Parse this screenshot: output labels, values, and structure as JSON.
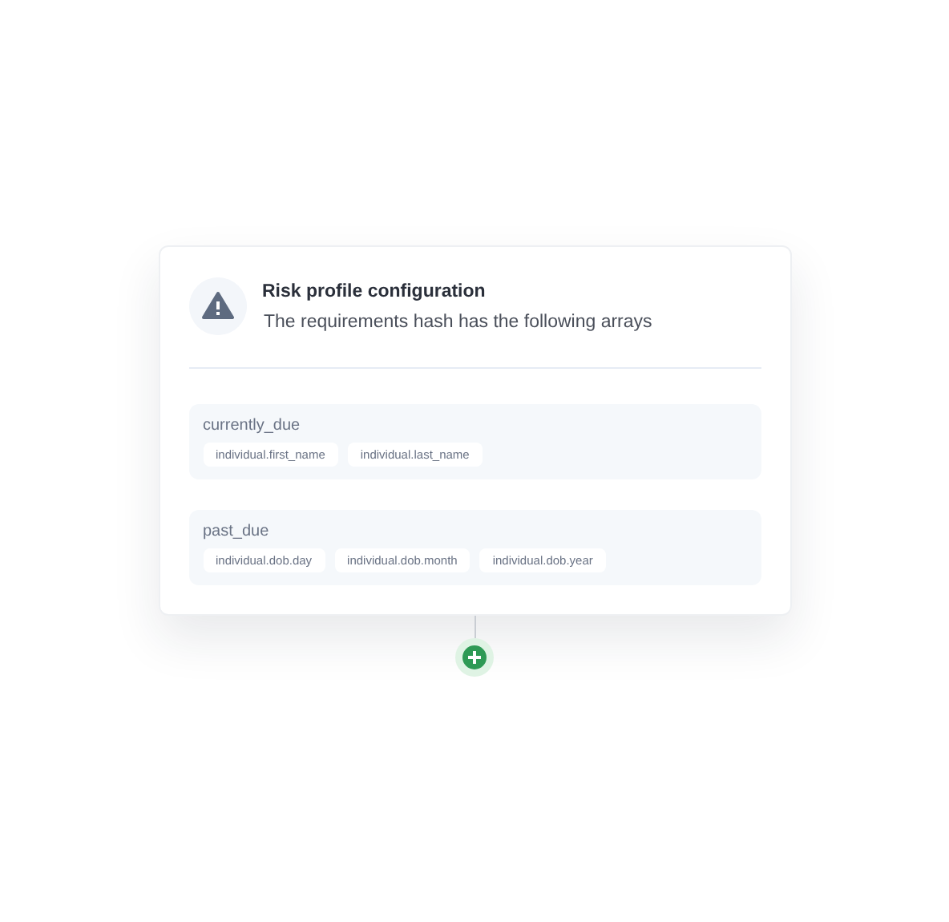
{
  "card": {
    "title": "Risk profile configuration",
    "subtitle": "The requirements hash has the following arrays",
    "groups": [
      {
        "name": "currently_due",
        "items": [
          "individual.first_name",
          "individual.last_name"
        ]
      },
      {
        "name": "past_due",
        "items": [
          "individual.dob.day",
          "individual.dob.month",
          "individual.dob.year"
        ]
      }
    ]
  }
}
